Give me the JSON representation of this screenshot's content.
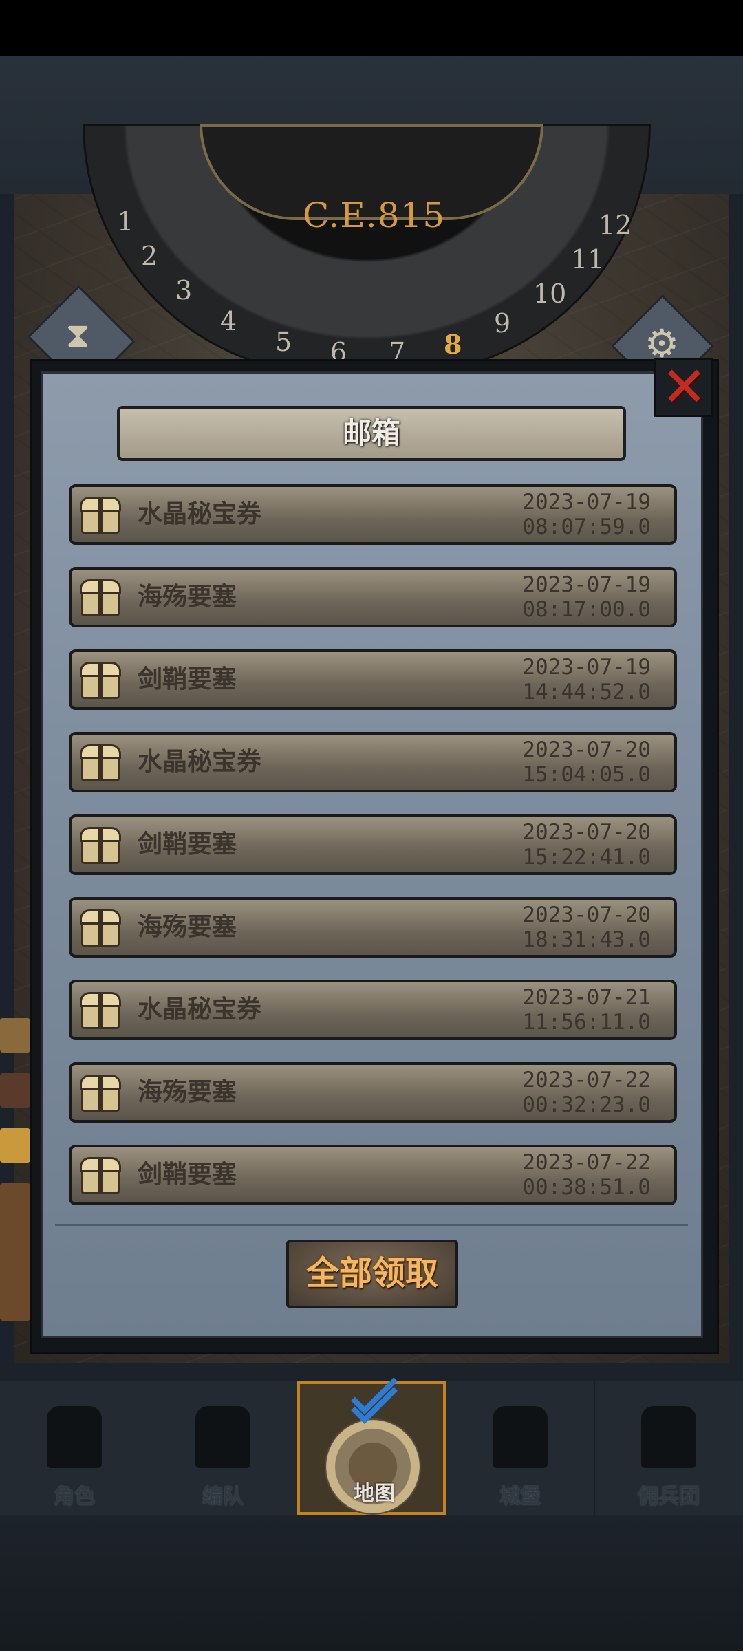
{
  "header": {
    "year": "C.E.815",
    "dial_numbers": [
      "1",
      "2",
      "3",
      "4",
      "5",
      "6",
      "7",
      "8",
      "9",
      "10",
      "11",
      "12"
    ],
    "current_dial": "8"
  },
  "mailbox": {
    "title": "邮箱",
    "close_icon": "close-x-icon",
    "items": [
      {
        "name": "水晶秘宝券",
        "date": "2023-07-19",
        "time": "08:07:59.0"
      },
      {
        "name": "海殇要塞",
        "date": "2023-07-19",
        "time": "08:17:00.0"
      },
      {
        "name": "剑鞘要塞",
        "date": "2023-07-19",
        "time": "14:44:52.0"
      },
      {
        "name": "水晶秘宝券",
        "date": "2023-07-20",
        "time": "15:04:05.0"
      },
      {
        "name": "剑鞘要塞",
        "date": "2023-07-20",
        "time": "15:22:41.0"
      },
      {
        "name": "海殇要塞",
        "date": "2023-07-20",
        "time": "18:31:43.0"
      },
      {
        "name": "水晶秘宝券",
        "date": "2023-07-21",
        "time": "11:56:11.0"
      },
      {
        "name": "海殇要塞",
        "date": "2023-07-22",
        "time": "00:32:23.0"
      },
      {
        "name": "剑鞘要塞",
        "date": "2023-07-22",
        "time": "00:38:51.0"
      }
    ],
    "claim_all_label": "全部领取"
  },
  "bottom_nav": {
    "items": [
      {
        "label": "角色",
        "icon": "knight-icon"
      },
      {
        "label": "编队",
        "icon": "helmet-icon"
      },
      {
        "label": "地图",
        "icon": "globe-icon",
        "active": true
      },
      {
        "label": "城堡",
        "icon": "castle-icon"
      },
      {
        "label": "佣兵团",
        "icon": "banner-icon"
      }
    ]
  },
  "colors": {
    "accent_gold": "#e2a845",
    "close_red": "#c52a20",
    "panel_blue": "#8d9bab",
    "active_tab_border": "#c2841c"
  }
}
